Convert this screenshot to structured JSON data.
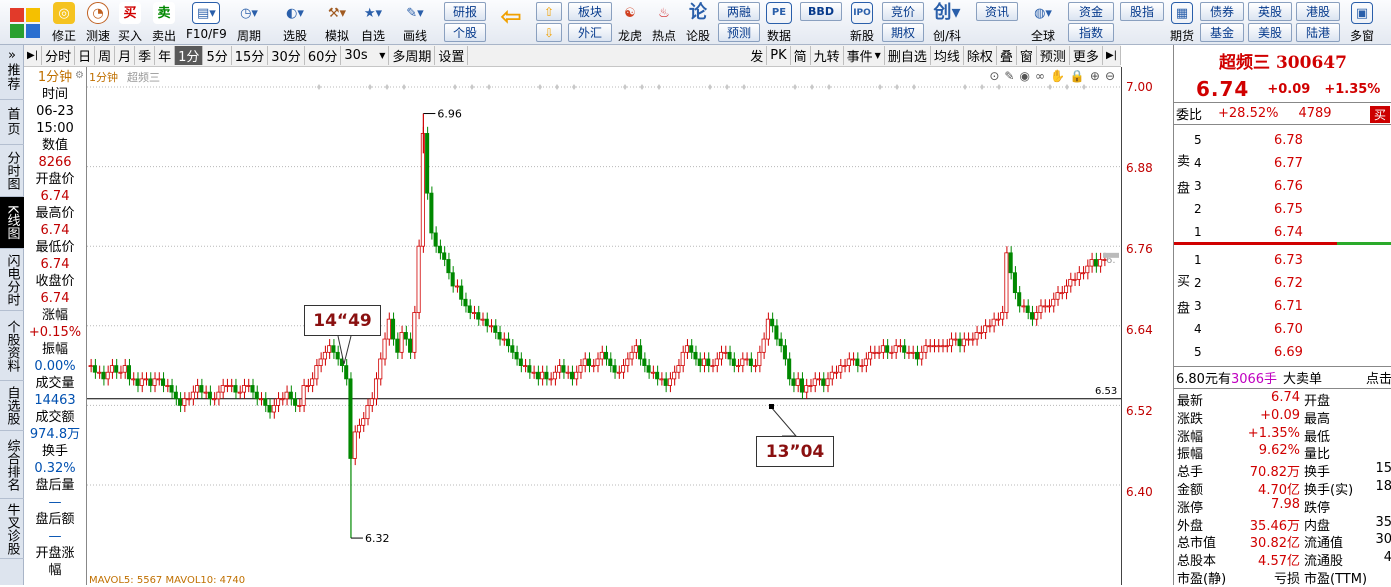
{
  "toolbar": {
    "items": [
      {
        "label": "修正",
        "icon": "revise-icon",
        "color": "#e8a20a",
        "glyph": "◎"
      },
      {
        "label": "测速",
        "icon": "speedometer-icon",
        "color": "#d08030",
        "glyph": "◔"
      },
      {
        "label": "买入",
        "icon": "buy-icon",
        "color": "#d00000",
        "glyph": "买"
      },
      {
        "label": "卖出",
        "icon": "sell-icon",
        "color": "#008800",
        "glyph": "卖"
      },
      {
        "label": "F10/F9",
        "icon": "f10-icon",
        "color": "#3a6fb8",
        "glyph": "▤"
      },
      {
        "label": "周期",
        "icon": "period-icon",
        "color": "#3a6fb8",
        "glyph": "◷"
      },
      {
        "label": "选股",
        "icon": "stock-picker-icon",
        "color": "#2a5faa",
        "glyph": "◐"
      },
      {
        "label": "模拟",
        "icon": "simulate-icon",
        "color": "#a05a20",
        "glyph": "⚒"
      },
      {
        "label": "自选",
        "icon": "watchlist-icon",
        "color": "#2a5faa",
        "glyph": "★"
      },
      {
        "label": "画线",
        "icon": "draw-line-icon",
        "color": "#2a5faa",
        "glyph": "✎"
      }
    ],
    "research": "研报",
    "stock": "个股",
    "sector": "板块",
    "forex": "外汇",
    "items2": [
      {
        "label": "龙虎",
        "icon": "dragon-tiger-icon",
        "color": "#d04020",
        "glyph": "☯"
      },
      {
        "label": "热点",
        "icon": "hot-icon",
        "color": "#d02020",
        "glyph": "♨"
      },
      {
        "label": "论股",
        "icon": "discuss-icon",
        "color": "#2a5faa",
        "glyph": "论"
      }
    ],
    "two_finance": "两融",
    "forecast": "预测",
    "data_label": "数据",
    "pe": "PE",
    "bbd": "BBD",
    "new_stock": "新股",
    "bid": "竞价",
    "options": "期权",
    "chuangke": "创/科",
    "news": "资讯",
    "global": "全球",
    "funds": "资金",
    "index": "指数",
    "stock_index": "股指",
    "period_label": "期货",
    "bonds": "债券",
    "fund": "基金",
    "uk_stock": "英股",
    "us_stock": "美股",
    "hk_stock": "港股",
    "lugang": "陆港",
    "multi_window": "多窗"
  },
  "leftbar": {
    "tabs": [
      {
        "label": "推荐",
        "active": false
      },
      {
        "label": "首页",
        "active": false
      },
      {
        "label": "分时图",
        "active": false
      },
      {
        "label": "K线图",
        "active": true
      },
      {
        "label": "闪电分时",
        "active": false
      },
      {
        "label": "个股资料",
        "active": false
      },
      {
        "label": "自选股",
        "active": false
      },
      {
        "label": "综合排名",
        "active": false
      },
      {
        "label": "牛叉诊股",
        "active": false
      }
    ]
  },
  "periodbar": {
    "tabs": [
      "分时",
      "日",
      "周",
      "月",
      "季",
      "年",
      "1分",
      "5分",
      "15分",
      "30分",
      "60分",
      "30s"
    ],
    "selected": "1分",
    "multi_period": "多周期",
    "settings": "设置",
    "right_tabs": [
      "发",
      "PK",
      "简",
      "九转",
      "事件",
      "删自选",
      "均线",
      "除权",
      "叠",
      "窗",
      "预测",
      "更多"
    ]
  },
  "chart_header": {
    "period_label": "1分钟",
    "stock_name": "超频三"
  },
  "infopanel": {
    "time_label": "时间",
    "date": "06-23",
    "time": "15:00",
    "value_label": "数值",
    "value": "8266",
    "open_label": "开盘价",
    "open": "6.74",
    "high_label": "最高价",
    "high": "6.74",
    "low_label": "最低价",
    "low": "6.74",
    "close_label": "收盘价",
    "close": "6.74",
    "change_label": "涨幅",
    "change": "+0.15%",
    "amplitude_label": "振幅",
    "amplitude": "0.00%",
    "volume_label": "成交量",
    "volume": "14463",
    "turnover_label": "成交额",
    "turnover": "974.8万",
    "turnover_rate_label": "换手",
    "turnover_rate": "0.32%",
    "after_vol_label": "盘后量",
    "after_vol": "—",
    "after_amt_label": "盘后额",
    "after_amt": "—",
    "open_change_label": "开盘涨幅"
  },
  "chart_data": {
    "type": "candlestick",
    "title": "超频三 300647 1分钟",
    "y_ticks": [
      "7.00",
      "6.88",
      "6.76",
      "6.64",
      "6.52",
      "6.40"
    ],
    "ylim": [
      6.28,
      7.0
    ],
    "max_marker": "6.96",
    "min_marker": "6.32",
    "price_line": "6.53",
    "annotation1": "14“49",
    "annotation2": "13”04",
    "right_edge_label": "6.",
    "volume_legend": "MAVOL5: 5567  MAVOL10: 4740",
    "series": [
      {
        "name": "price",
        "values": [
          6.58,
          6.57,
          6.57,
          6.56,
          6.57,
          6.58,
          6.57,
          6.57,
          6.58,
          6.56,
          6.56,
          6.55,
          6.56,
          6.56,
          6.55,
          6.56,
          6.56,
          6.55,
          6.55,
          6.54,
          6.53,
          6.52,
          6.53,
          6.53,
          6.54,
          6.55,
          6.54,
          6.54,
          6.53,
          6.53,
          6.54,
          6.55,
          6.55,
          6.55,
          6.54,
          6.54,
          6.55,
          6.55,
          6.54,
          6.53,
          6.53,
          6.52,
          6.51,
          6.52,
          6.53,
          6.53,
          6.54,
          6.53,
          6.52,
          6.52,
          6.55,
          6.55,
          6.56,
          6.58,
          6.59,
          6.6,
          6.61,
          6.6,
          6.59,
          6.58,
          6.56,
          6.44,
          6.48,
          6.49,
          6.5,
          6.52,
          6.53,
          6.56,
          6.59,
          6.62,
          6.65,
          6.62,
          6.6,
          6.63,
          6.62,
          6.6,
          6.66,
          6.76,
          6.93,
          6.84,
          6.78,
          6.76,
          6.75,
          6.74,
          6.72,
          6.7,
          6.7,
          6.68,
          6.67,
          6.66,
          6.66,
          6.65,
          6.65,
          6.64,
          6.64,
          6.63,
          6.62,
          6.62,
          6.61,
          6.6,
          6.59,
          6.58,
          6.58,
          6.57,
          6.57,
          6.56,
          6.57,
          6.56,
          6.56,
          6.57,
          6.58,
          6.57,
          6.57,
          6.56,
          6.57,
          6.58,
          6.59,
          6.58,
          6.58,
          6.59,
          6.6,
          6.59,
          6.58,
          6.57,
          6.57,
          6.58,
          6.59,
          6.6,
          6.61,
          6.59,
          6.58,
          6.57,
          6.57,
          6.56,
          6.56,
          6.55,
          6.56,
          6.57,
          6.58,
          6.6,
          6.61,
          6.6,
          6.59,
          6.58,
          6.59,
          6.58,
          6.58,
          6.59,
          6.6,
          6.6,
          6.59,
          6.58,
          6.58,
          6.59,
          6.59,
          6.58,
          6.58,
          6.6,
          6.62,
          6.65,
          6.64,
          6.62,
          6.61,
          6.59,
          6.56,
          6.55,
          6.56,
          6.54,
          6.55,
          6.55,
          6.56,
          6.56,
          6.55,
          6.56,
          6.57,
          6.57,
          6.58,
          6.58,
          6.59,
          6.59,
          6.58,
          6.58,
          6.59,
          6.6,
          6.6,
          6.6,
          6.61,
          6.6,
          6.6,
          6.61,
          6.61,
          6.6,
          6.6,
          6.6,
          6.59,
          6.6,
          6.61,
          6.61,
          6.61,
          6.61,
          6.61,
          6.61,
          6.62,
          6.62,
          6.61,
          6.62,
          6.62,
          6.62,
          6.63,
          6.63,
          6.64,
          6.64,
          6.65,
          6.65,
          6.66,
          6.75,
          6.72,
          6.69,
          6.67,
          6.67,
          6.66,
          6.65,
          6.66,
          6.67,
          6.67,
          6.67,
          6.68,
          6.69,
          6.69,
          6.7,
          6.71,
          6.71,
          6.72,
          6.72,
          6.73,
          6.74,
          6.73,
          6.74,
          6.74
        ]
      }
    ]
  },
  "rightpanel": {
    "title": "超频三 300647",
    "price": "6.74",
    "change": "+0.09",
    "change_pct": "+1.35%",
    "weibi_label": "委比",
    "weibi": "+28.52%",
    "weicha": "4789",
    "weicha_btn": "买",
    "sell_label": "卖盘",
    "buy_label": "买盘",
    "asks": [
      {
        "lvl": "5",
        "price": "6.78"
      },
      {
        "lvl": "4",
        "price": "6.77"
      },
      {
        "lvl": "3",
        "price": "6.76"
      },
      {
        "lvl": "2",
        "price": "6.75"
      },
      {
        "lvl": "1",
        "price": "6.74"
      }
    ],
    "bids": [
      {
        "lvl": "1",
        "price": "6.73"
      },
      {
        "lvl": "2",
        "price": "6.72"
      },
      {
        "lvl": "3",
        "price": "6.71"
      },
      {
        "lvl": "4",
        "price": "6.70"
      },
      {
        "lvl": "5",
        "price": "6.69"
      }
    ],
    "big_order_price": "6.80元有",
    "big_order_vol": "3066手",
    "big_order_label": "大卖单",
    "big_order_more": "点击",
    "stats": [
      {
        "l": "最新",
        "v": "6.74",
        "l2": "开盘",
        "v2": ""
      },
      {
        "l": "涨跌",
        "v": "+0.09",
        "l2": "最高",
        "v2": ""
      },
      {
        "l": "涨幅",
        "v": "+1.35%",
        "l2": "最低",
        "v2": ""
      },
      {
        "l": "振幅",
        "v": "9.62%",
        "l2": "量比",
        "v2": ""
      },
      {
        "l": "总手",
        "v": "70.82万",
        "l2": "换手",
        "v2": "15"
      },
      {
        "l": "金额",
        "v": "4.70亿",
        "l2": "换手(实)",
        "v2": "18"
      },
      {
        "l": "涨停",
        "v": "7.98",
        "l2": "跌停",
        "v2": ""
      },
      {
        "l": "外盘",
        "v": "35.46万",
        "l2": "内盘",
        "v2": "35"
      },
      {
        "l": "总市值",
        "v": "30.82亿",
        "l2": "流通值",
        "v2": "30"
      },
      {
        "l": "总股本",
        "v": "4.57亿",
        "l2": "流通股",
        "v2": "4"
      },
      {
        "l": "市盈(静)",
        "v": "亏损",
        "l2": "市盈(TTM)",
        "v2": ""
      }
    ]
  }
}
